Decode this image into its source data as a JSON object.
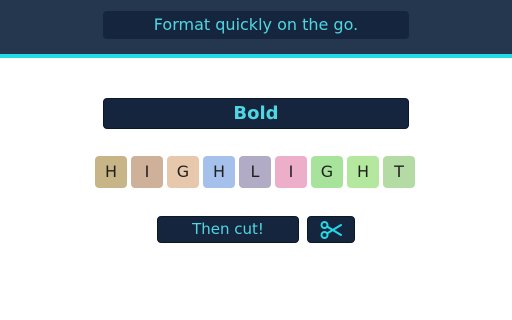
{
  "header": {
    "tagline": "Format quickly on the go.",
    "background": "#24374e",
    "accent_color": "#22d9e6"
  },
  "main": {
    "bold_label": "Bold",
    "highlight_tiles": [
      {
        "letter": "H",
        "color": "#c7b487"
      },
      {
        "letter": "I",
        "color": "#cfb199"
      },
      {
        "letter": "G",
        "color": "#e8c8ad"
      },
      {
        "letter": "H",
        "color": "#a5c0ea"
      },
      {
        "letter": "L",
        "color": "#b2abc6"
      },
      {
        "letter": "I",
        "color": "#ecaec8"
      },
      {
        "letter": "G",
        "color": "#a7e39b"
      },
      {
        "letter": "H",
        "color": "#b5e89f"
      },
      {
        "letter": "T",
        "color": "#b4dba4"
      }
    ],
    "cut_label": "Then cut!",
    "cut_icon": "scissors-icon"
  },
  "colors": {
    "button_bg": "#14253d",
    "button_text": "#4fd6e2"
  }
}
